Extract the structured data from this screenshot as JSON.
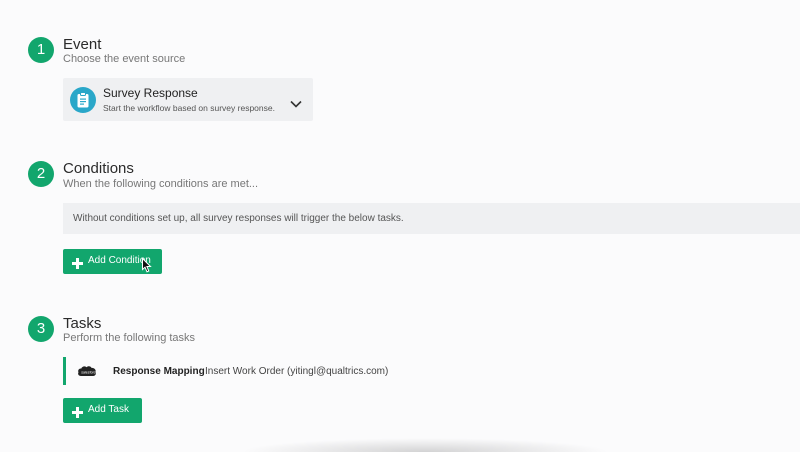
{
  "accent_color": "#12a66d",
  "event": {
    "number": "1",
    "title": "Event",
    "subtitle": "Choose the event source",
    "source": {
      "icon": "clipboard-icon",
      "title": "Survey Response",
      "description": "Start the workflow based on survey response."
    }
  },
  "conditions": {
    "number": "2",
    "title": "Conditions",
    "subtitle": "When the following conditions are met...",
    "notice": "Without conditions set up, all survey responses will trigger the below tasks.",
    "add_button_label": "Add Condition"
  },
  "tasks": {
    "number": "3",
    "title": "Tasks",
    "subtitle": "Perform the following tasks",
    "items": [
      {
        "icon": "salesforce-logo-icon",
        "name": "Response Mapping",
        "description": "Insert Work Order (yitingl@qualtrics.com)"
      }
    ],
    "add_button_label": "Add Task"
  }
}
